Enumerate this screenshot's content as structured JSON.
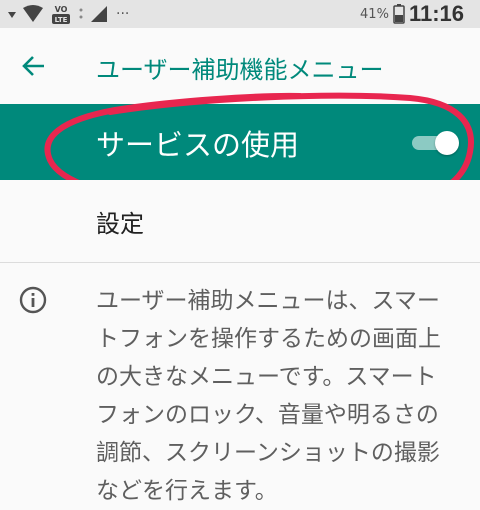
{
  "status_bar": {
    "icons": [
      "signal-down-icon",
      "wifi-icon",
      "volte-icon",
      "sim-icon",
      "cellular-icon",
      "more-dots-icon"
    ],
    "volte_label": "LTE",
    "dots": "···",
    "battery_percent": "41%",
    "time": "11:16"
  },
  "app_bar": {
    "back_icon": "arrow-left-icon",
    "title": "ユーザー補助機能メニュー"
  },
  "master_switch": {
    "label": "サービスの使用",
    "on": true
  },
  "settings": {
    "label": "設定"
  },
  "info": {
    "icon": "info-icon",
    "lines": [
      "ユーザー補助メニューは、スマー",
      "トフォンを操作するための画面上",
      "の大きなメニューです。スマート",
      "フォンのロック、音量や明るさの",
      "調節、スクリーンショットの撮影",
      "などを行えます。"
    ]
  },
  "colors": {
    "accent": "#00897b",
    "annotation": "#e8264f",
    "background": "#fafafa",
    "status_bar": "#e4e4e4"
  }
}
